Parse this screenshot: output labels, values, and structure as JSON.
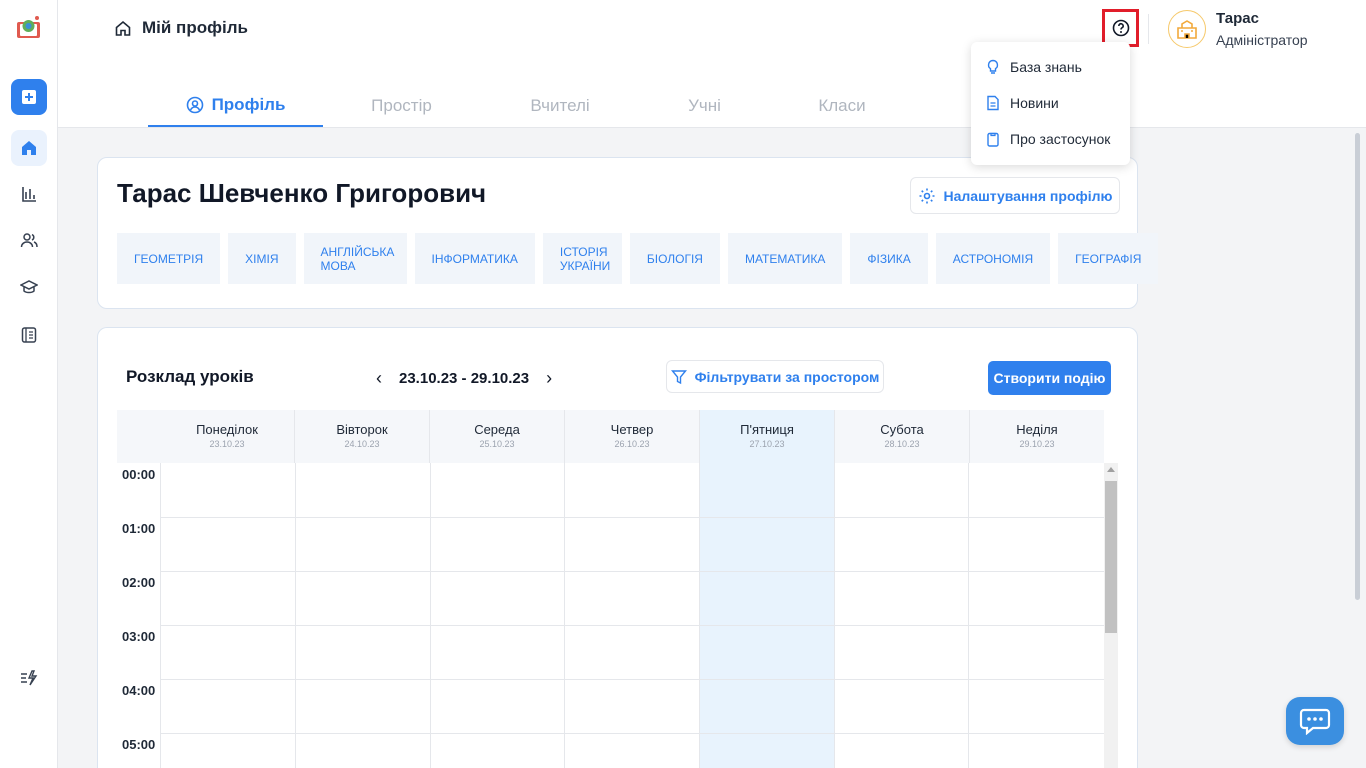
{
  "header": {
    "breadcrumb": "Мій профіль",
    "user": {
      "name": "Тарас",
      "role": "Адміністратор"
    }
  },
  "tabs": [
    {
      "label": "Профіль",
      "active": true
    },
    {
      "label": "Простір",
      "active": false
    },
    {
      "label": "Вчителі",
      "active": false
    },
    {
      "label": "Учні",
      "active": false
    },
    {
      "label": "Класи",
      "active": false
    }
  ],
  "help_menu": {
    "items": [
      {
        "label": "База знань",
        "icon": "lightbulb-icon"
      },
      {
        "label": "Новини",
        "icon": "document-icon"
      },
      {
        "label": "Про застосунок",
        "icon": "clipboard-icon"
      }
    ]
  },
  "profile": {
    "full_name": "Тарас Шевченко Григорович",
    "settings_label": "Налаштування профілю",
    "subjects": [
      "ГЕОМЕТРІЯ",
      "ХІМІЯ",
      "АНГЛІЙСЬКА МОВА",
      "ІНФОРМАТИКА",
      "ІСТОРІЯ УКРАЇНИ",
      "БІОЛОГІЯ",
      "МАТЕМАТИКА",
      "ФІЗИКА",
      "АСТРОНОМІЯ",
      "ГЕОГРАФІЯ"
    ]
  },
  "schedule": {
    "title": "Розклад уроків",
    "week_range": "23.10.23 - 29.10.23",
    "filter_label": "Фільтрувати за простором",
    "create_label": "Створити подію",
    "days": [
      {
        "name": "Понеділок",
        "date": "23.10.23"
      },
      {
        "name": "Вівторок",
        "date": "24.10.23"
      },
      {
        "name": "Середа",
        "date": "25.10.23"
      },
      {
        "name": "Четвер",
        "date": "26.10.23"
      },
      {
        "name": "П'ятниця",
        "date": "27.10.23"
      },
      {
        "name": "Субота",
        "date": "28.10.23"
      },
      {
        "name": "Неділя",
        "date": "29.10.23"
      }
    ],
    "hours": [
      "00:00",
      "01:00",
      "02:00",
      "03:00",
      "04:00",
      "05:00"
    ]
  },
  "colors": {
    "accent": "#2f80ed",
    "highlight_day": "#e8f3fd",
    "help_outline": "#e11d2a"
  }
}
